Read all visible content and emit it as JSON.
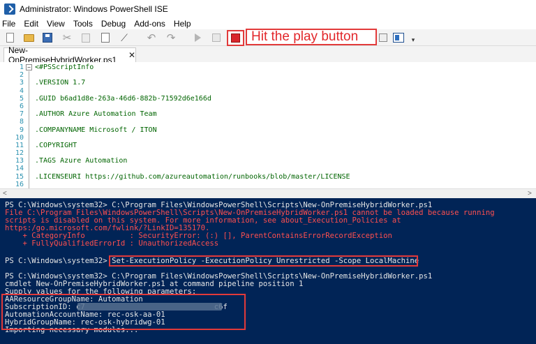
{
  "window": {
    "title": "Administrator: Windows PowerShell ISE"
  },
  "menu": [
    "File",
    "Edit",
    "View",
    "Tools",
    "Debug",
    "Add-ons",
    "Help"
  ],
  "annotation": {
    "text": "Hit the play button",
    "color": "#e2272b"
  },
  "tab": {
    "label": "New-OnPremiseHybridWorker.ps1",
    "close": "✕"
  },
  "editor": {
    "line_numbers": [
      "1",
      "2",
      "3",
      "4",
      "5",
      "6",
      "7",
      "8",
      "9",
      "10",
      "11",
      "12",
      "13",
      "14",
      "15",
      "16"
    ],
    "lines": [
      "<#PSScriptInfo",
      "",
      ".VERSION 1.7",
      "",
      ".GUID b6ad1d8e-263a-46d6-882b-71592d6e166d",
      "",
      ".AUTHOR Azure Automation Team",
      "",
      ".COMPANYNAME Microsoft / ITON",
      "",
      ".COPYRIGHT",
      "",
      ".TAGS Azure Automation",
      "",
      ".LICENSEURI https://github.com/azureautomation/runbooks/blob/master/LICENSE",
      ""
    ]
  },
  "console": {
    "lines": [
      {
        "text": "PS C:\\Windows\\system32> C:\\Program Files\\WindowsPowerShell\\Scripts\\New-OnPremiseHybridWorker.ps1",
        "error": false
      },
      {
        "text": "File C:\\Program Files\\WindowsPowerShell\\Scripts\\New-OnPremiseHybridWorker.ps1 cannot be loaded because running",
        "error": true
      },
      {
        "text": "scripts is disabled on this system. For more information, see about_Execution_Policies at",
        "error": true
      },
      {
        "text": "https:/go.microsoft.com/fwlink/?LinkID=135170.",
        "error": true
      },
      {
        "text": "    + CategoryInfo          : SecurityError: (:) [], ParentContainsErrorRecordException",
        "error": true
      },
      {
        "text": "    + FullyQualifiedErrorId : UnauthorizedAccess",
        "error": true
      },
      {
        "text": "",
        "error": false
      },
      {
        "text": "PS C:\\Windows\\system32> Set-ExecutionPolicy -ExecutionPolicy Unrestricted -Scope LocalMachine",
        "error": false
      },
      {
        "text": "",
        "error": false
      },
      {
        "text": "PS C:\\Windows\\system32> C:\\Program Files\\WindowsPowerShell\\Scripts\\New-OnPremiseHybridWorker.ps1",
        "error": false
      },
      {
        "text": "cmdlet New-OnPremiseHybridWorker.ps1 at command pipeline position 1",
        "error": false
      },
      {
        "text": "Supply values for the following parameters:",
        "error": false
      },
      {
        "text": "AAResourceGroupName: Automation",
        "error": false
      },
      {
        "text": "SubscriptionID: c7                             c6f",
        "error": false
      },
      {
        "text": "AutomationAccountName: rec-osk-aa-01",
        "error": false
      },
      {
        "text": "HybridGroupName: rec-osk-hybridwg-01",
        "error": false
      },
      {
        "text": "Importing necessary modules...",
        "error": false
      }
    ]
  },
  "colors": {
    "console_bg": "#012456",
    "error": "#ff4f4f",
    "highlight": "#e23a3a"
  }
}
